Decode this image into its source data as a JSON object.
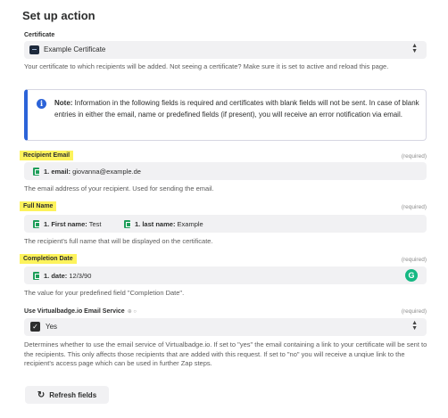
{
  "page": {
    "title": "Set up action"
  },
  "certificate": {
    "label": "Certificate",
    "value": "Example Certificate",
    "helper": "Your certificate to which recipients will be added. Not seeing a certificate? Make sure it is set to active and reload this page."
  },
  "note": {
    "bold": "Note:",
    "text": " Information in the following fields is required and certificates with blank fields will not be sent. In case of blank entries in either the email, name or predefined fields (if present), you will receive an error notification via email."
  },
  "recipient_email": {
    "label": "Recipient Email",
    "required": "(required)",
    "pill_key": "1. email:",
    "pill_value": " giovanna@example.de",
    "helper": "The email address of your recipient. Used for sending the email."
  },
  "full_name": {
    "label": "Full Name",
    "required": "(required)",
    "pill1_key": "1. First name:",
    "pill1_value": " Test",
    "pill2_key": "1. last name:",
    "pill2_value": " Example",
    "helper": "The recipient's full name that will be displayed on the certificate."
  },
  "completion_date": {
    "label": "Completion Date",
    "required": "(required)",
    "pill_key": "1. date:",
    "pill_value": " 12/3/90",
    "badge": "G",
    "helper": "The value for your predefined field \"Completion Date\"."
  },
  "email_service": {
    "label": "Use Virtualbadge.io Email Service",
    "label_icons": "⊕ ○",
    "required": "(required)",
    "value": "Yes",
    "helper": "Determines whether to use the email service of Virtualbadge.io. If set to \"yes\" the email containing a link to your certificate will be sent to the recipients. This only affects those recipients that are added with this request. If set to \"no\" you will receive a unqiue link to the recipient's access page which can be used in further Zap steps."
  },
  "refresh": {
    "label": "Refresh fields"
  },
  "colors": {
    "highlight": "#fdf35c",
    "accent": "#2c63d8",
    "sheets": "#1e9e5a",
    "badge": "#16b883"
  }
}
